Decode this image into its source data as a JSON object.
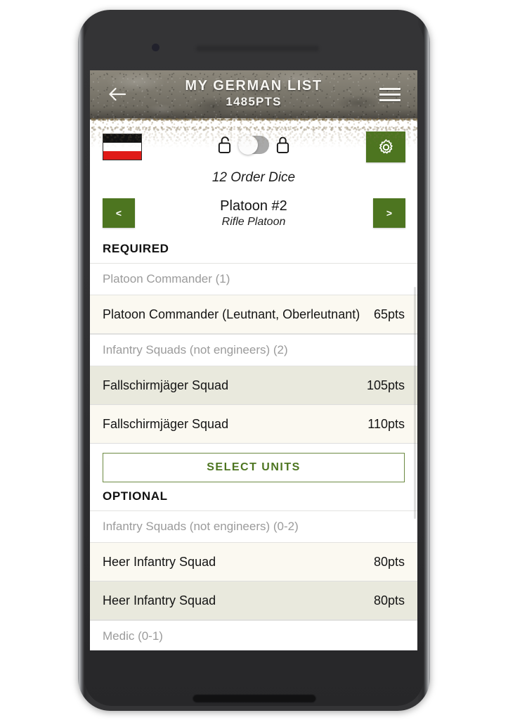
{
  "header": {
    "title": "MY GERMAN LIST",
    "subtitle": "1485PTS",
    "back_icon": "back-arrow-icon",
    "menu_icon": "hamburger-menu-icon"
  },
  "controls": {
    "flag": {
      "name": "german-flag",
      "bands": [
        "#121212",
        "#ffffff",
        "#e01b18"
      ]
    },
    "unlocked_icon": "unlocked-padlock-icon",
    "locked_icon": "locked-padlock-icon",
    "toggle": {
      "name": "lock-toggle",
      "state": "off",
      "track_color": "#a9a9a9",
      "knob_color": "#fcfcfc"
    },
    "settings_icon": "gear-icon",
    "settings_color": "#4d7520"
  },
  "order_dice": "12 Order Dice",
  "platoon": {
    "prev_label": "<",
    "next_label": ">",
    "name": "Platoon #2",
    "type": "Rifle Platoon"
  },
  "select_units_label": "SELECT UNITS",
  "accent_green": "#4d7520",
  "sections": [
    {
      "heading": "REQUIRED",
      "groups": [
        {
          "category": "Platoon Commander (1)",
          "units": [
            {
              "name": "Platoon Commander (Leutnant, Oberleutnant)",
              "points": "65pts"
            }
          ]
        },
        {
          "category": "Infantry Squads (not engineers) (2)",
          "units": [
            {
              "name": "Fallschirmjäger Squad",
              "points": "105pts"
            },
            {
              "name": "Fallschirmjäger Squad",
              "points": "110pts"
            }
          ]
        }
      ]
    },
    {
      "heading": "OPTIONAL",
      "groups": [
        {
          "category": "Infantry Squads (not engineers) (0-2)",
          "units": [
            {
              "name": "Heer Infantry Squad",
              "points": "80pts"
            },
            {
              "name": "Heer Infantry Squad",
              "points": "80pts"
            }
          ]
        },
        {
          "category": "Medic (0-1)",
          "units": []
        }
      ]
    }
  ]
}
